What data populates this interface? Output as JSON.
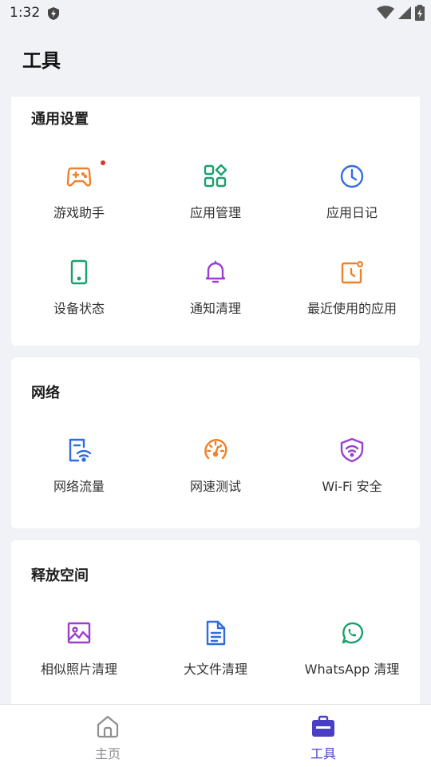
{
  "status_bar": {
    "time": "1:32"
  },
  "page": {
    "title": "工具"
  },
  "sections": [
    {
      "title": "通用设置",
      "items": [
        {
          "label": "游戏助手",
          "icon": "gamepad-icon"
        },
        {
          "label": "应用管理",
          "icon": "apps-grid-icon"
        },
        {
          "label": "应用日记",
          "icon": "clock-icon"
        },
        {
          "label": "设备状态",
          "icon": "phone-icon"
        },
        {
          "label": "通知清理",
          "icon": "bell-icon"
        },
        {
          "label": "最近使用的应用",
          "icon": "recent-apps-icon"
        }
      ]
    },
    {
      "title": "网络",
      "items": [
        {
          "label": "网络流量",
          "icon": "data-usage-icon"
        },
        {
          "label": "网速测试",
          "icon": "speedometer-icon"
        },
        {
          "label": "Wi-Fi 安全",
          "icon": "wifi-shield-icon"
        }
      ]
    },
    {
      "title": "释放空间",
      "items": [
        {
          "label": "相似照片清理",
          "icon": "image-icon"
        },
        {
          "label": "大文件清理",
          "icon": "document-icon"
        },
        {
          "label": "WhatsApp 清理",
          "icon": "whatsapp-icon"
        }
      ]
    }
  ],
  "bottom_nav": {
    "items": [
      {
        "label": "主页",
        "icon": "home-icon"
      },
      {
        "label": "工具",
        "icon": "toolbox-icon"
      }
    ],
    "active_color": "#4a3fc4",
    "inactive_color": "#8e8e93"
  },
  "colors": {
    "orange": "#f0802b",
    "green": "#19a16b",
    "blue": "#2f6de1",
    "purple": "#9b3fd0"
  }
}
